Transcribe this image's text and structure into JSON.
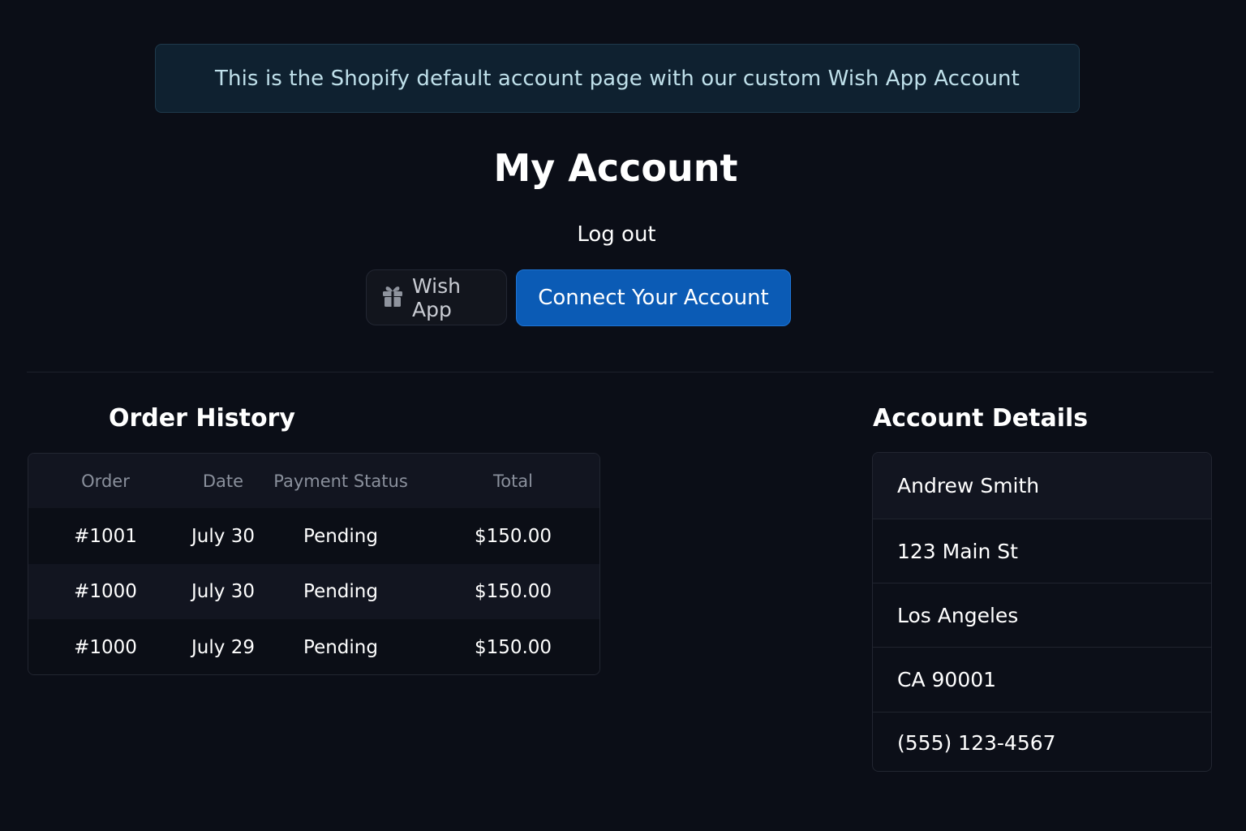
{
  "banner": {
    "text": "This is the Shopify default account page with our custom Wish App Account"
  },
  "page": {
    "title": "My Account",
    "logout_label": "Log out"
  },
  "actions": {
    "wish_app_label": "Wish App",
    "wish_app_icon": "gift-icon",
    "connect_label": "Connect Your Account"
  },
  "orders": {
    "title": "Order History",
    "columns": [
      "Order",
      "Date",
      "Payment Status",
      "Total"
    ],
    "rows": [
      {
        "order": "#1001",
        "date": "July 30",
        "status": "Pending",
        "total": "$150.00"
      },
      {
        "order": "#1000",
        "date": "July 30",
        "status": "Pending",
        "total": "$150.00"
      },
      {
        "order": "#1000",
        "date": "July 29",
        "status": "Pending",
        "total": "$150.00"
      }
    ]
  },
  "account": {
    "title": "Account Details",
    "name": "Andrew Smith",
    "street": "123 Main St",
    "city": "Los Angeles",
    "state_zip": "CA 90001",
    "phone": "(555) 123-4567"
  },
  "colors": {
    "background": "#0b0e17",
    "banner_bg": "#0f2130",
    "primary_button": "#0b5bb5",
    "banner_text": "#bfe0ea"
  }
}
